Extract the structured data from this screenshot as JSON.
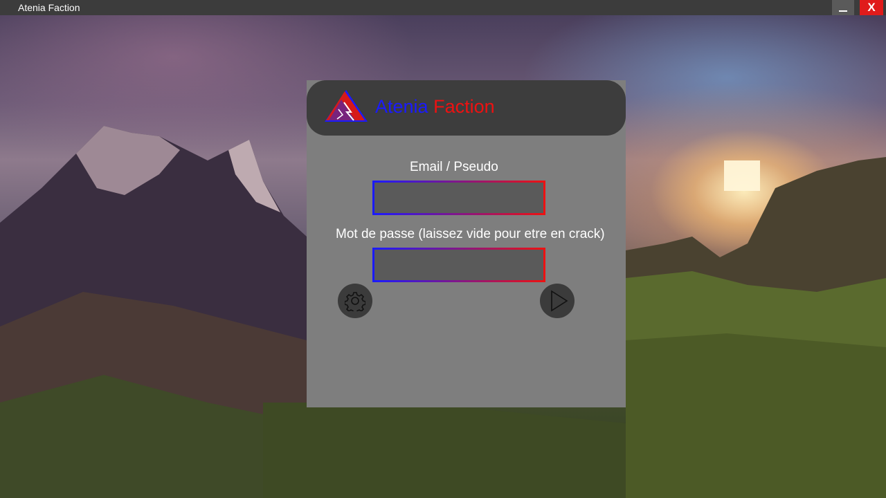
{
  "window": {
    "title": "Atenia Faction",
    "minimize_label": "_",
    "close_label": "X"
  },
  "panel": {
    "brand_word_1": "Atenia",
    "brand_word_2": "Faction",
    "email_label": "Email / Pseudo",
    "email_value": "",
    "password_label": "Mot de passe (laissez vide pour etre en crack)",
    "password_value": "",
    "settings_icon": "gear-icon",
    "play_icon": "play-icon"
  },
  "colors": {
    "brand_blue": "#1a1aff",
    "brand_red": "#ee1111",
    "panel_bg": "#7e7e7e",
    "header_bg": "#3d3d3d",
    "close_button": "#e01b1b"
  }
}
